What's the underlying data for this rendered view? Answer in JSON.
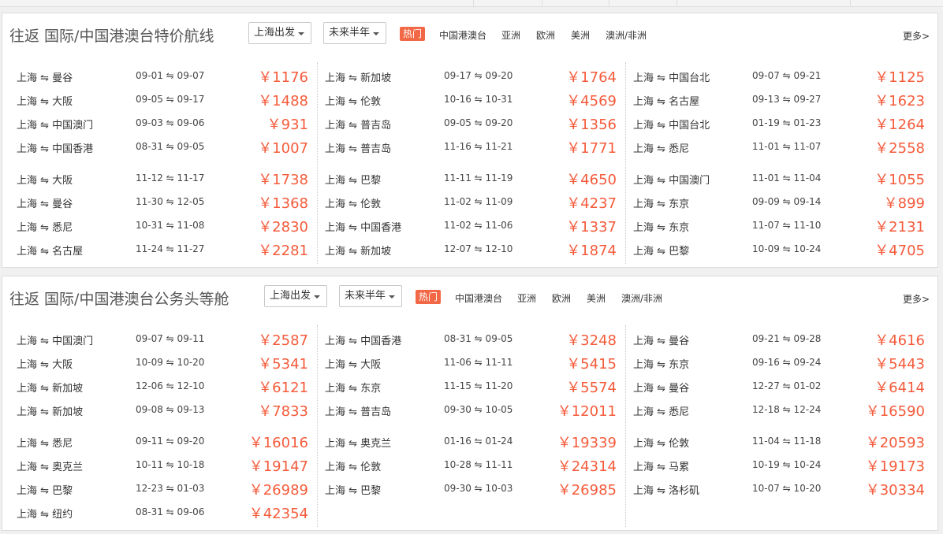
{
  "sections": [
    {
      "title": "往返 国际/中国港澳台特价航线",
      "depart_select": "上海出发",
      "period_select": "未来半年",
      "hot_tab": "热门",
      "filters": [
        "中国港澳台",
        "亚洲",
        "欧洲",
        "美洲",
        "澳洲/非洲"
      ],
      "more": "更多>",
      "columns": [
        [
          {
            "route": "上海 ⇋ 曼谷",
            "dates": "09-01 ⇋ 09-07",
            "price": "￥1176"
          },
          {
            "route": "上海 ⇋ 大阪",
            "dates": "09-05 ⇋ 09-17",
            "price": "￥1488"
          },
          {
            "route": "上海 ⇋ 中国澳门",
            "dates": "09-03 ⇋ 09-06",
            "price": "￥931"
          },
          {
            "route": "上海 ⇋ 中国香港",
            "dates": "08-31 ⇋ 09-05",
            "price": "￥1007"
          },
          {
            "route": "上海 ⇋ 大阪",
            "dates": "11-12 ⇋ 11-17",
            "price": "￥1738"
          },
          {
            "route": "上海 ⇋ 曼谷",
            "dates": "11-30 ⇋ 12-05",
            "price": "￥1368"
          },
          {
            "route": "上海 ⇋ 悉尼",
            "dates": "10-31 ⇋ 11-08",
            "price": "￥2830"
          },
          {
            "route": "上海 ⇋ 名古屋",
            "dates": "11-24 ⇋ 11-27",
            "price": "￥2281"
          }
        ],
        [
          {
            "route": "上海 ⇋ 新加坡",
            "dates": "09-17 ⇋ 09-20",
            "price": "￥1764"
          },
          {
            "route": "上海 ⇋ 伦敦",
            "dates": "10-16 ⇋ 10-31",
            "price": "￥4569"
          },
          {
            "route": "上海 ⇋ 普吉岛",
            "dates": "09-05 ⇋ 09-20",
            "price": "￥1356"
          },
          {
            "route": "上海 ⇋ 普吉岛",
            "dates": "11-16 ⇋ 11-21",
            "price": "￥1771"
          },
          {
            "route": "上海 ⇋ 巴黎",
            "dates": "11-11 ⇋ 11-19",
            "price": "￥4650"
          },
          {
            "route": "上海 ⇋ 伦敦",
            "dates": "11-02 ⇋ 11-09",
            "price": "￥4237"
          },
          {
            "route": "上海 ⇋ 中国香港",
            "dates": "11-02 ⇋ 11-06",
            "price": "￥1337"
          },
          {
            "route": "上海 ⇋ 新加坡",
            "dates": "12-07 ⇋ 12-10",
            "price": "￥1874"
          }
        ],
        [
          {
            "route": "上海 ⇋ 中国台北",
            "dates": "09-07 ⇋ 09-21",
            "price": "￥1125"
          },
          {
            "route": "上海 ⇋ 名古屋",
            "dates": "09-13 ⇋ 09-27",
            "price": "￥1623"
          },
          {
            "route": "上海 ⇋ 中国台北",
            "dates": "01-19 ⇋ 01-23",
            "price": "￥1264"
          },
          {
            "route": "上海 ⇋ 悉尼",
            "dates": "11-01 ⇋ 11-07",
            "price": "￥2558"
          },
          {
            "route": "上海 ⇋ 中国澳门",
            "dates": "11-01 ⇋ 11-04",
            "price": "￥1055"
          },
          {
            "route": "上海 ⇋ 东京",
            "dates": "09-09 ⇋ 09-14",
            "price": "￥899"
          },
          {
            "route": "上海 ⇋ 东京",
            "dates": "11-07 ⇋ 11-10",
            "price": "￥2131"
          },
          {
            "route": "上海 ⇋ 巴黎",
            "dates": "10-09 ⇋ 10-24",
            "price": "￥4705"
          }
        ]
      ]
    },
    {
      "title": "往返 国际/中国港澳台公务头等舱",
      "depart_select": "上海出发",
      "period_select": "未来半年",
      "hot_tab": "热门",
      "filters": [
        "中国港澳台",
        "亚洲",
        "欧洲",
        "美洲",
        "澳洲/非洲"
      ],
      "more": "更多>",
      "columns": [
        [
          {
            "route": "上海 ⇋ 中国澳门",
            "dates": "09-07 ⇋ 09-11",
            "price": "￥2587"
          },
          {
            "route": "上海 ⇋ 大阪",
            "dates": "10-09 ⇋ 10-20",
            "price": "￥5341"
          },
          {
            "route": "上海 ⇋ 新加坡",
            "dates": "12-06 ⇋ 12-10",
            "price": "￥6121"
          },
          {
            "route": "上海 ⇋ 新加坡",
            "dates": "09-08 ⇋ 09-13",
            "price": "￥7833"
          },
          {
            "route": "上海 ⇋ 悉尼",
            "dates": "09-11 ⇋ 09-20",
            "price": "￥16016"
          },
          {
            "route": "上海 ⇋ 奥克兰",
            "dates": "10-11 ⇋ 10-18",
            "price": "￥19147"
          },
          {
            "route": "上海 ⇋ 巴黎",
            "dates": "12-23 ⇋ 01-03",
            "price": "￥26989"
          },
          {
            "route": "上海 ⇋ 纽约",
            "dates": "08-31 ⇋ 09-06",
            "price": "￥42354"
          }
        ],
        [
          {
            "route": "上海 ⇋ 中国香港",
            "dates": "08-31 ⇋ 09-05",
            "price": "￥3248"
          },
          {
            "route": "上海 ⇋ 大阪",
            "dates": "11-06 ⇋ 11-11",
            "price": "￥5415"
          },
          {
            "route": "上海 ⇋ 东京",
            "dates": "11-15 ⇋ 11-20",
            "price": "￥5574"
          },
          {
            "route": "上海 ⇋ 普吉岛",
            "dates": "09-30 ⇋ 10-05",
            "price": "￥12011"
          },
          {
            "route": "上海 ⇋ 奥克兰",
            "dates": "01-16 ⇋ 01-24",
            "price": "￥19339"
          },
          {
            "route": "上海 ⇋ 伦敦",
            "dates": "10-28 ⇋ 11-11",
            "price": "￥24314"
          },
          {
            "route": "上海 ⇋ 巴黎",
            "dates": "09-30 ⇋ 10-03",
            "price": "￥26985"
          }
        ],
        [
          {
            "route": "上海 ⇋ 曼谷",
            "dates": "09-21 ⇋ 09-28",
            "price": "￥4616"
          },
          {
            "route": "上海 ⇋ 东京",
            "dates": "09-16 ⇋ 09-24",
            "price": "￥5443"
          },
          {
            "route": "上海 ⇋ 曼谷",
            "dates": "12-27 ⇋ 01-02",
            "price": "￥6414"
          },
          {
            "route": "上海 ⇋ 悉尼",
            "dates": "12-18 ⇋ 12-24",
            "price": "￥16590"
          },
          {
            "route": "上海 ⇋ 伦敦",
            "dates": "11-04 ⇋ 11-18",
            "price": "￥20593"
          },
          {
            "route": "上海 ⇋ 马累",
            "dates": "10-19 ⇋ 10-24",
            "price": "￥19173"
          },
          {
            "route": "上海 ⇋ 洛杉矶",
            "dates": "10-07 ⇋ 10-20",
            "price": "￥30334"
          }
        ]
      ]
    }
  ]
}
